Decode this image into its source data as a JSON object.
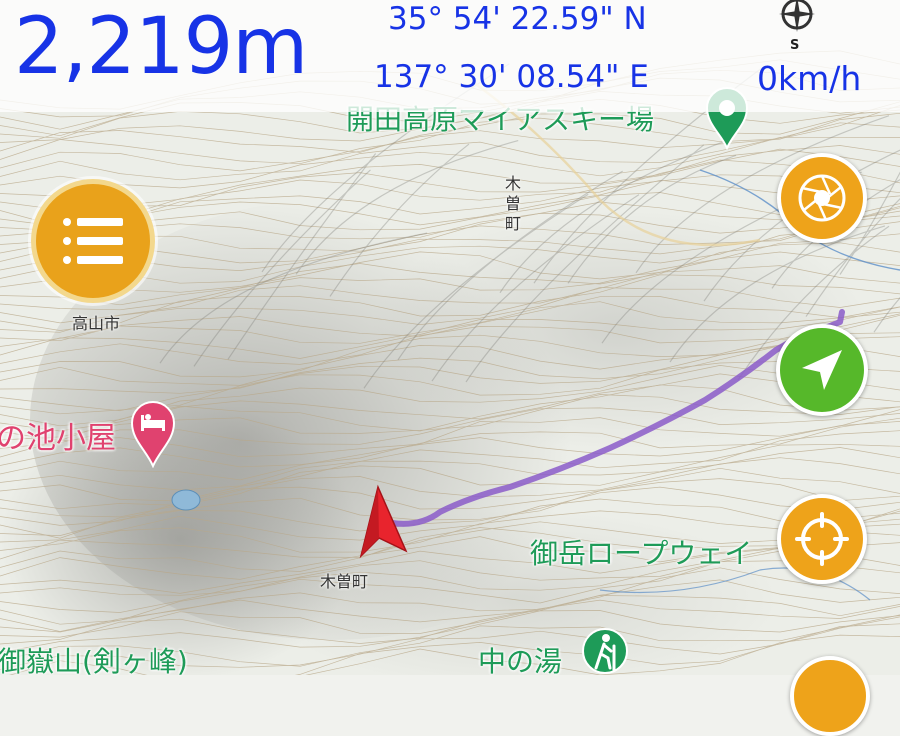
{
  "header": {
    "altitude": "2,219m",
    "latitude": "35° 54' 22.59\" N",
    "longitude": "137° 30' 08.54\" E",
    "speed": "0km/h",
    "compass_south": "S"
  },
  "map": {
    "labels": {
      "ski_resort": "開田高原マイアスキー場",
      "lodge": "の池小屋",
      "ropeway": "御岳ロープウェイ",
      "nakanoyu": "中の湯",
      "peak": "御嶽山(剣ヶ峰)",
      "kiso_town_lower": "木曽町",
      "kiso_town_upper_1": "木",
      "kiso_town_upper_2": "曽",
      "kiso_town_upper_3": "町",
      "takayama_city": "高山市"
    },
    "track_color": "#8b5cc9",
    "position_marker_color": "#e8242d",
    "icons": {
      "ski_pin": "green-map-pin-icon",
      "lodge_pin": "pink-bed-pin-icon",
      "hiking_pin": "green-hiker-pin-icon"
    }
  },
  "controls": {
    "menu_icon": "list-menu-icon",
    "layers_icon": "aperture-icon",
    "locate_icon": "navigation-arrow-icon",
    "target_icon": "crosshair-target-icon",
    "colors": {
      "orange": "#eea31a",
      "green": "#56b82a",
      "text_blue": "#1733e6"
    }
  }
}
